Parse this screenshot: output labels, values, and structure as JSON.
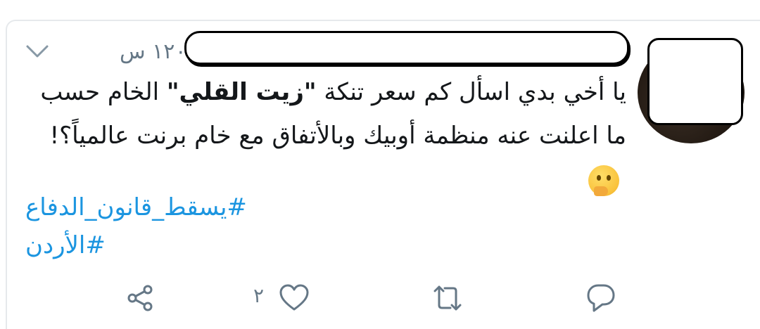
{
  "tweet": {
    "timestamp": "١٢ س",
    "separator": "·",
    "text_line1_pre": "يا أخي بدي اسأل كم سعر تنكة ",
    "text_bold": "\"زيت القلي\"",
    "text_line1_post": " الخام حسب ما اعلنت عنه منظمة أوبيك وبالأتفاق مع خام برنت عالمياً؟! ",
    "emoji": "thinking-face",
    "hashtags": [
      "#يسقط_قانون_الدفاع",
      "#الأردن"
    ]
  },
  "actions": {
    "like_count": "٢"
  },
  "colors": {
    "text": "#14171a",
    "secondary": "#657786",
    "link": "#1b95e0",
    "border": "#e6e9ec"
  },
  "icons": {
    "menu": "chevron-down-icon",
    "share": "share-icon",
    "like": "heart-icon",
    "retweet": "retweet-icon",
    "reply": "reply-icon"
  }
}
